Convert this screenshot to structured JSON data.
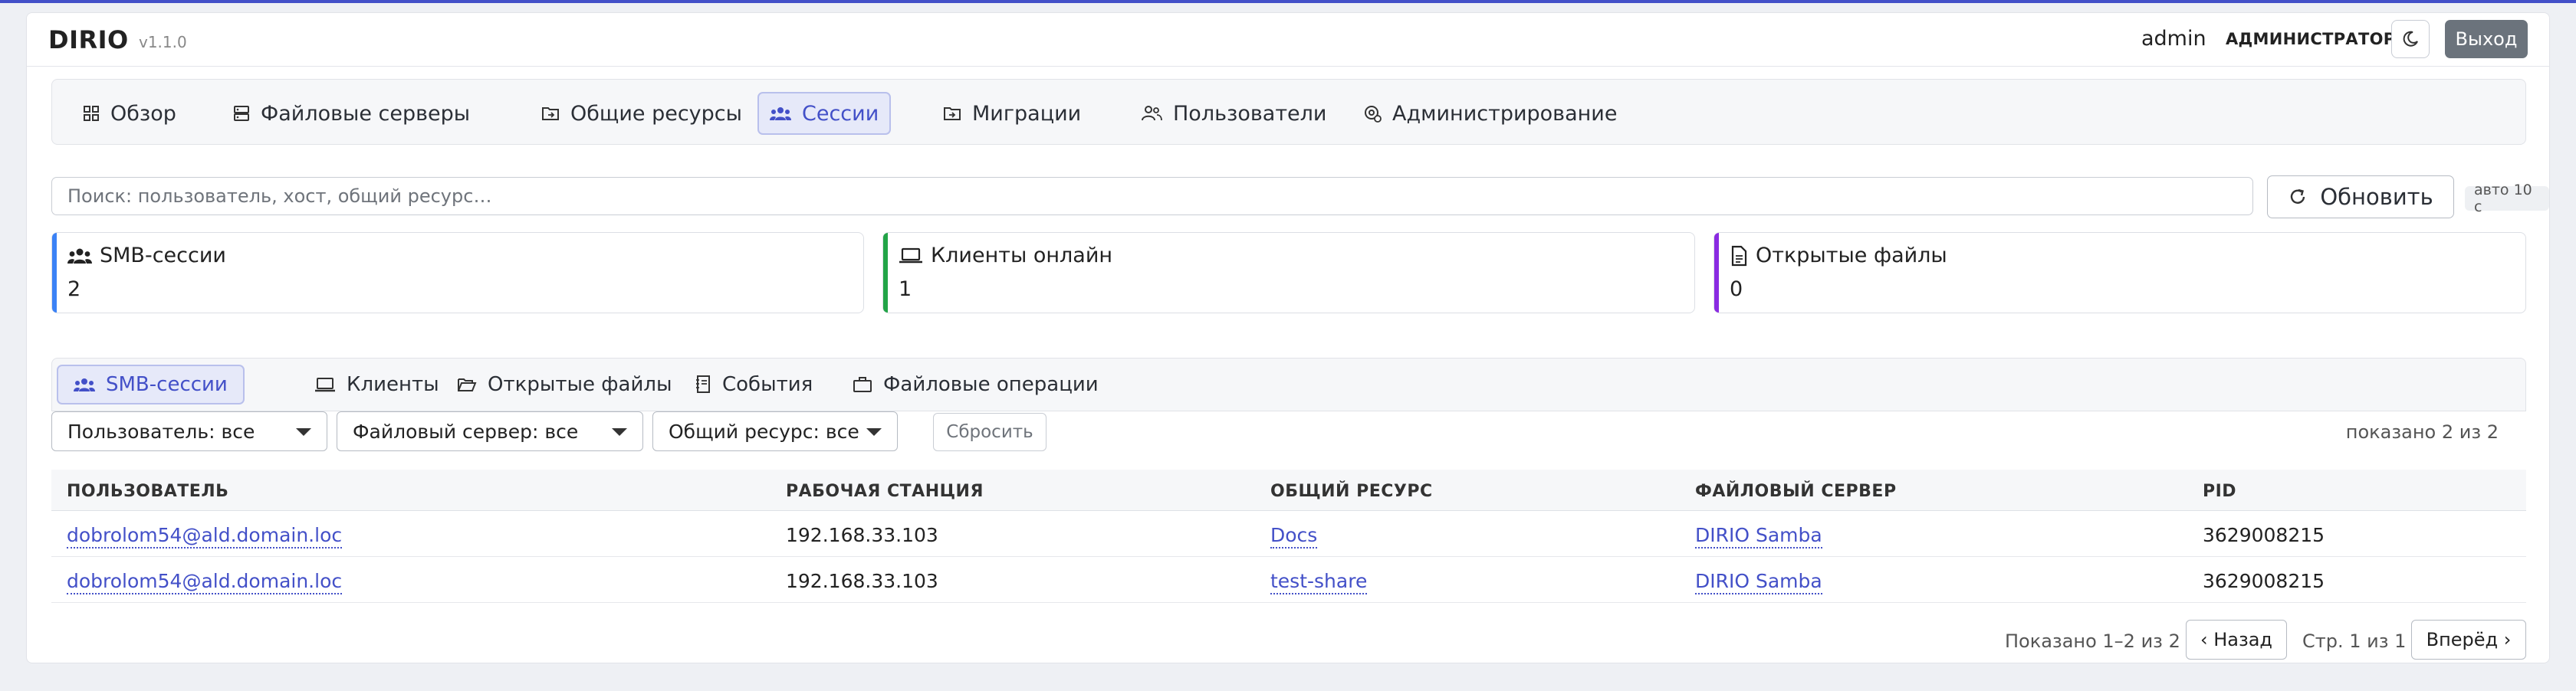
{
  "header": {
    "brand": "DIRIO",
    "version": "v1.1.0",
    "user": "admin",
    "role": "АДМИНИСТРАТОР",
    "logout_label": "Выход"
  },
  "nav": {
    "items": [
      {
        "label": "Обзор",
        "icon": "grid-icon"
      },
      {
        "label": "Файловые серверы",
        "icon": "server-icon"
      },
      {
        "label": "Общие ресурсы",
        "icon": "folder-share-icon"
      },
      {
        "label": "Сессии",
        "icon": "users-icon",
        "active": true
      },
      {
        "label": "Миграции",
        "icon": "folder-arrow-icon"
      },
      {
        "label": "Пользователи",
        "icon": "user-icon"
      },
      {
        "label": "Администрирование",
        "icon": "gear-person-icon"
      }
    ]
  },
  "search": {
    "placeholder": "Поиск: пользователь, хост, общий ресурс…",
    "value": ""
  },
  "refresh_label": "Обновить",
  "auto_label": "авто 10 с",
  "stats": [
    {
      "title": "SMB-сессии",
      "value": "2",
      "color": "#3b82f6",
      "icon": "users-icon"
    },
    {
      "title": "Клиенты онлайн",
      "value": "1",
      "color": "#22a447",
      "icon": "laptop-icon"
    },
    {
      "title": "Открытые файлы",
      "value": "0",
      "color": "#8a2be2",
      "icon": "file-icon"
    }
  ],
  "tabs": [
    {
      "label": "SMB-сессии",
      "icon": "users-icon",
      "active": true
    },
    {
      "label": "Клиенты",
      "icon": "laptop-icon"
    },
    {
      "label": "Открытые файлы",
      "icon": "folder-open-icon"
    },
    {
      "label": "События",
      "icon": "journal-icon"
    },
    {
      "label": "Файловые операции",
      "icon": "briefcase-icon"
    }
  ],
  "filters": {
    "user": "Пользователь: все",
    "server": "Файловый сервер: все",
    "share": "Общий ресурс: все",
    "reset_label": "Сбросить",
    "shown": "показано 2 из 2"
  },
  "table": {
    "columns": [
      "ПОЛЬЗОВАТЕЛЬ",
      "РАБОЧАЯ СТАНЦИЯ",
      "ОБЩИЙ РЕСУРС",
      "ФАЙЛОВЫЙ СЕРВЕР",
      "PID"
    ],
    "rows": [
      {
        "user": "dobrolom54@ald.domain.loc",
        "workstation": "192.168.33.103",
        "share": "Docs",
        "server": "DIRIO Samba",
        "pid": "3629008215"
      },
      {
        "user": "dobrolom54@ald.domain.loc",
        "workstation": "192.168.33.103",
        "share": "test-share",
        "server": "DIRIO Samba",
        "pid": "3629008215"
      }
    ]
  },
  "pager": {
    "summary": "Показано 1–2 из 2",
    "prev_label": "‹ Назад",
    "page": "Стр. 1 из 1",
    "next_label": "Вперёд ›"
  }
}
